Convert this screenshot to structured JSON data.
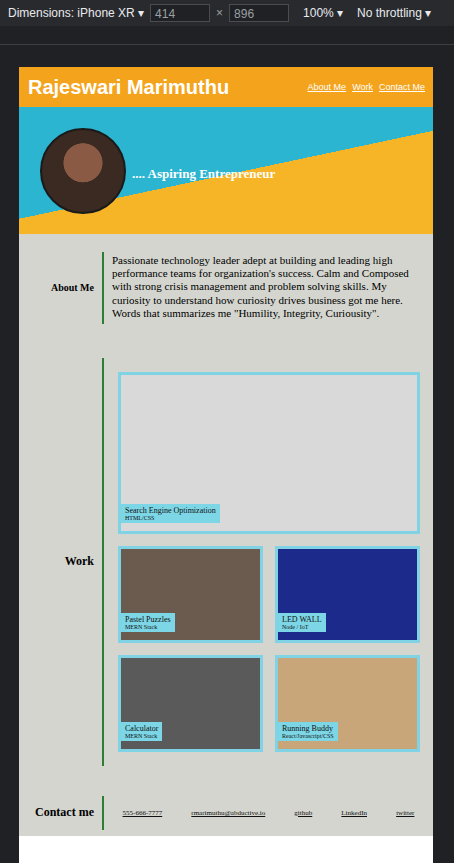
{
  "devtools": {
    "device": "Dimensions: iPhone XR",
    "caret": "▾",
    "width": "414",
    "times": "×",
    "height": "896",
    "zoom": "100%",
    "throttling": "No throttling"
  },
  "header": {
    "name": "Rajeswari Marimuthu",
    "nav": [
      "About Me",
      "Work",
      "Contact Me"
    ]
  },
  "hero": {
    "tagline": ".... Aspiring Entrepreneur"
  },
  "about": {
    "label": "About Me",
    "text": "Passionate technology leader adept at building and leading high performance teams for organization's success. Calm and Composed with strong crisis management and problem solving skills. My curiosity to understand how curiosity drives business got me here. Words that summarizes me \"Humility, Integrity, Curiousity\"."
  },
  "work": {
    "label": "Work",
    "projects": [
      {
        "title": "Search Engine Optimization",
        "tech": "HTML/CSS",
        "featured": true,
        "color": "#d9d9d9"
      },
      {
        "title": "Pastel Puzzles",
        "tech": "MERN Stack",
        "featured": false,
        "color": "#6b5a4e"
      },
      {
        "title": "LED WALL",
        "tech": "Node / IoT",
        "featured": false,
        "color": "#1c2a8c"
      },
      {
        "title": "Calculator",
        "tech": "MERN Stack",
        "featured": false,
        "color": "#5a5a5a"
      },
      {
        "title": "Running Buddy",
        "tech": "React/Javascript/CSS",
        "featured": false,
        "color": "#c9a57a"
      }
    ]
  },
  "contact": {
    "label": "Contact me",
    "links": [
      "555-666-7777",
      "rmarimuthu@abductive.io",
      "github",
      "LinkedIn",
      "twitter"
    ]
  }
}
